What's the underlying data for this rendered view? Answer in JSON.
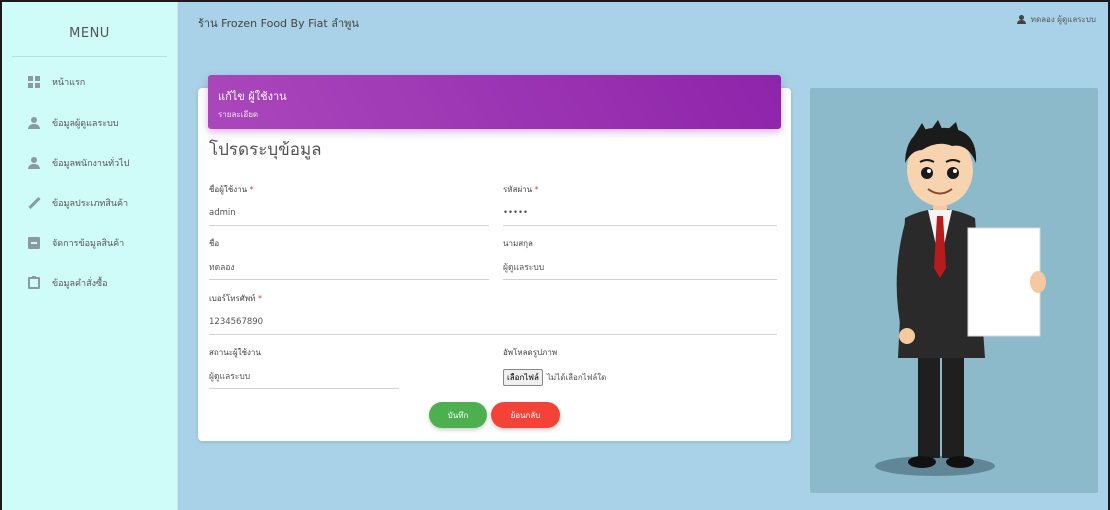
{
  "sidebar": {
    "title": "MENU",
    "items": [
      {
        "label": "หน้าแรก",
        "icon": "dashboard-icon"
      },
      {
        "label": "ข้อมูลผู้ดูแลระบบ",
        "icon": "person-icon"
      },
      {
        "label": "ข้อมูลพนักงานทั่วไป",
        "icon": "person-icon"
      },
      {
        "label": "ข้อมูลประเภทสินค้า",
        "icon": "pencil-icon"
      },
      {
        "label": "จัดการข้อมูลสินค้า",
        "icon": "archive-icon"
      },
      {
        "label": "ข้อมูลคำสั่งซื้อ",
        "icon": "clipboard-icon"
      }
    ]
  },
  "header": {
    "title": "ร้าน Frozen Food By Fiat ลำพูน",
    "user": "ทดลอง ผู้ดูแลระบบ"
  },
  "card": {
    "title": "แก้ไข ผู้ใช้งาน",
    "subtitle": "รายละเอียด",
    "section": "โปรดระบุข้อมูล"
  },
  "form": {
    "username": {
      "label": "ชื่อผู้ใช้งาน",
      "value": "admin"
    },
    "password": {
      "label": "รหัสผ่าน",
      "value": "•••••"
    },
    "firstname": {
      "label": "ชื่อ",
      "value": "ทดลอง"
    },
    "lastname": {
      "label": "นามสกุล",
      "value": "ผู้ดูแลระบบ"
    },
    "phone": {
      "label": "เบอร์โทรศัพท์",
      "value": "1234567890"
    },
    "status": {
      "label": "สถานะผู้ใช้งาน",
      "value": "ผู้ดูแลระบบ"
    },
    "upload": {
      "label": "อัพโหลดรูปภาพ",
      "button": "เลือกไฟล์",
      "status": "ไม่ได้เลือกไฟล์ใด"
    },
    "required_mark": "*"
  },
  "buttons": {
    "save": "บันทึก",
    "back": "ย้อนกลับ"
  },
  "colors": {
    "page_bg": "#a9d2e8",
    "sidebar_bg": "#cffbf9",
    "card_header": "#9c27b0",
    "save": "#4caf50",
    "back": "#f44336"
  }
}
